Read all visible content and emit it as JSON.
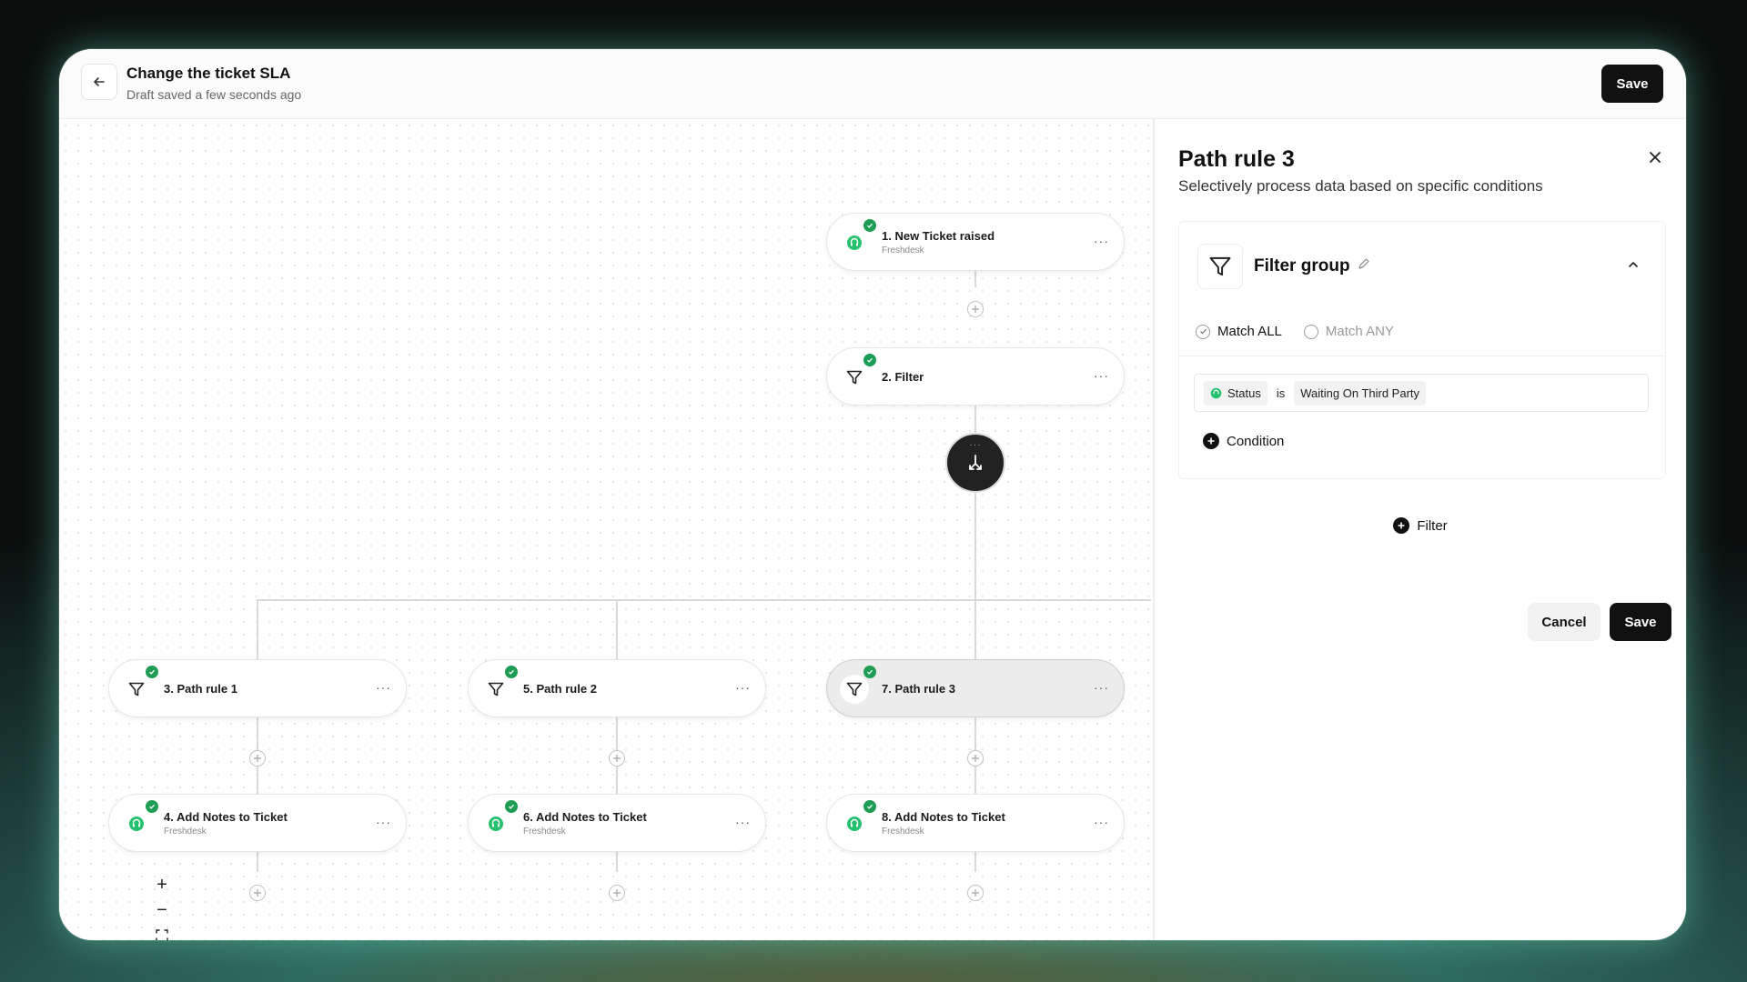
{
  "header": {
    "title": "Change the ticket SLA",
    "subtitle": "Draft saved a few seconds ago",
    "save_label": "Save"
  },
  "nodes": [
    {
      "label": "1. New Ticket raised",
      "sub": "Freshdesk",
      "icon": "freshdesk-icon"
    },
    {
      "label": "2. Filter",
      "sub": "",
      "icon": "filter-icon"
    },
    {
      "label": "3. Path rule 1",
      "sub": "",
      "icon": "filter-icon"
    },
    {
      "label": "5. Path rule 2",
      "sub": "",
      "icon": "filter-icon"
    },
    {
      "label": "7. Path rule 3",
      "sub": "",
      "icon": "filter-icon"
    },
    {
      "label": "4. Add Notes to Ticket",
      "sub": "Freshdesk",
      "icon": "freshdesk-icon"
    },
    {
      "label": "6. Add Notes to Ticket",
      "sub": "Freshdesk",
      "icon": "freshdesk-icon"
    },
    {
      "label": "8. Add Notes to Ticket",
      "sub": "Freshdesk",
      "icon": "freshdesk-icon"
    }
  ],
  "node_more_label": "···",
  "zoom": {
    "zoom_in": "+",
    "zoom_out": "−"
  },
  "panel": {
    "title": "Path rule 3",
    "description": "Selectively process data based on specific conditions",
    "filter_group": {
      "title": "Filter group",
      "match_all": "Match ALL",
      "match_any": "Match ANY",
      "selected": "Match ALL",
      "condition": {
        "field": "Status",
        "operator": "is",
        "value": "Waiting On Third Party"
      },
      "add_condition_label": "Condition"
    },
    "add_filter_label": "Filter",
    "cancel_label": "Cancel",
    "save_label": "Save"
  },
  "colors": {
    "accent": "#111111",
    "success": "#1f9d55",
    "freshdesk": "#25c16f"
  }
}
